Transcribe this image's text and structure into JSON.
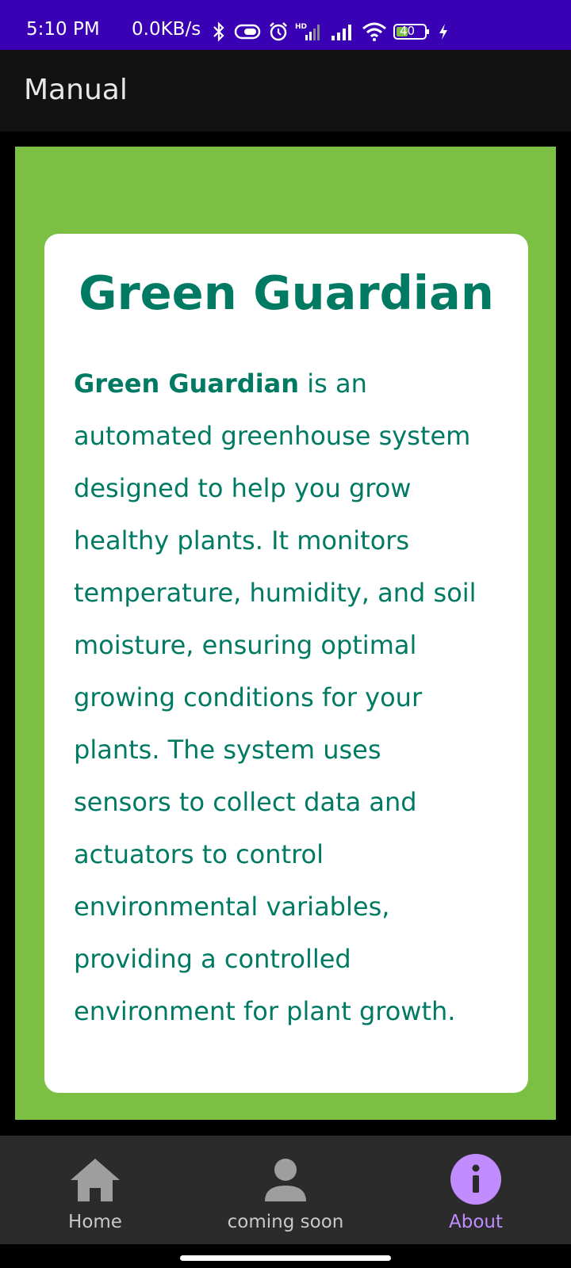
{
  "status_bar": {
    "time": "5:10 PM",
    "network_speed": "0.0KB/s",
    "battery_level": "40",
    "icons": [
      "bluetooth-icon",
      "vibrate-icon",
      "alarm-icon",
      "hd-signal-icon",
      "signal-icon",
      "wifi-icon",
      "battery-icon",
      "charging-icon"
    ],
    "color": "#3a00b3"
  },
  "app_bar": {
    "title": "Manual"
  },
  "card": {
    "title": "Green Guardian",
    "body_bold": "Green Guardian",
    "body_lines": [
      " is an",
      "automated greenhouse system",
      "designed to help you grow",
      "healthy plants. It monitors",
      "temperature, humidity, and soil",
      "moisture, ensuring optimal",
      "growing conditions for your",
      "plants. The system uses",
      "sensors to collect data and",
      "actuators to control",
      "environmental variables,",
      "providing a controlled",
      "environment for plant growth."
    ],
    "accent_color": "#007a63",
    "panel_color": "#7bc043"
  },
  "bottom_nav": {
    "items": [
      {
        "label": "Home",
        "icon": "home-icon",
        "active": false
      },
      {
        "label": "coming soon",
        "icon": "person-icon",
        "active": false
      },
      {
        "label": "About",
        "icon": "info-icon",
        "active": true
      }
    ],
    "active_color": "#c08cff"
  }
}
